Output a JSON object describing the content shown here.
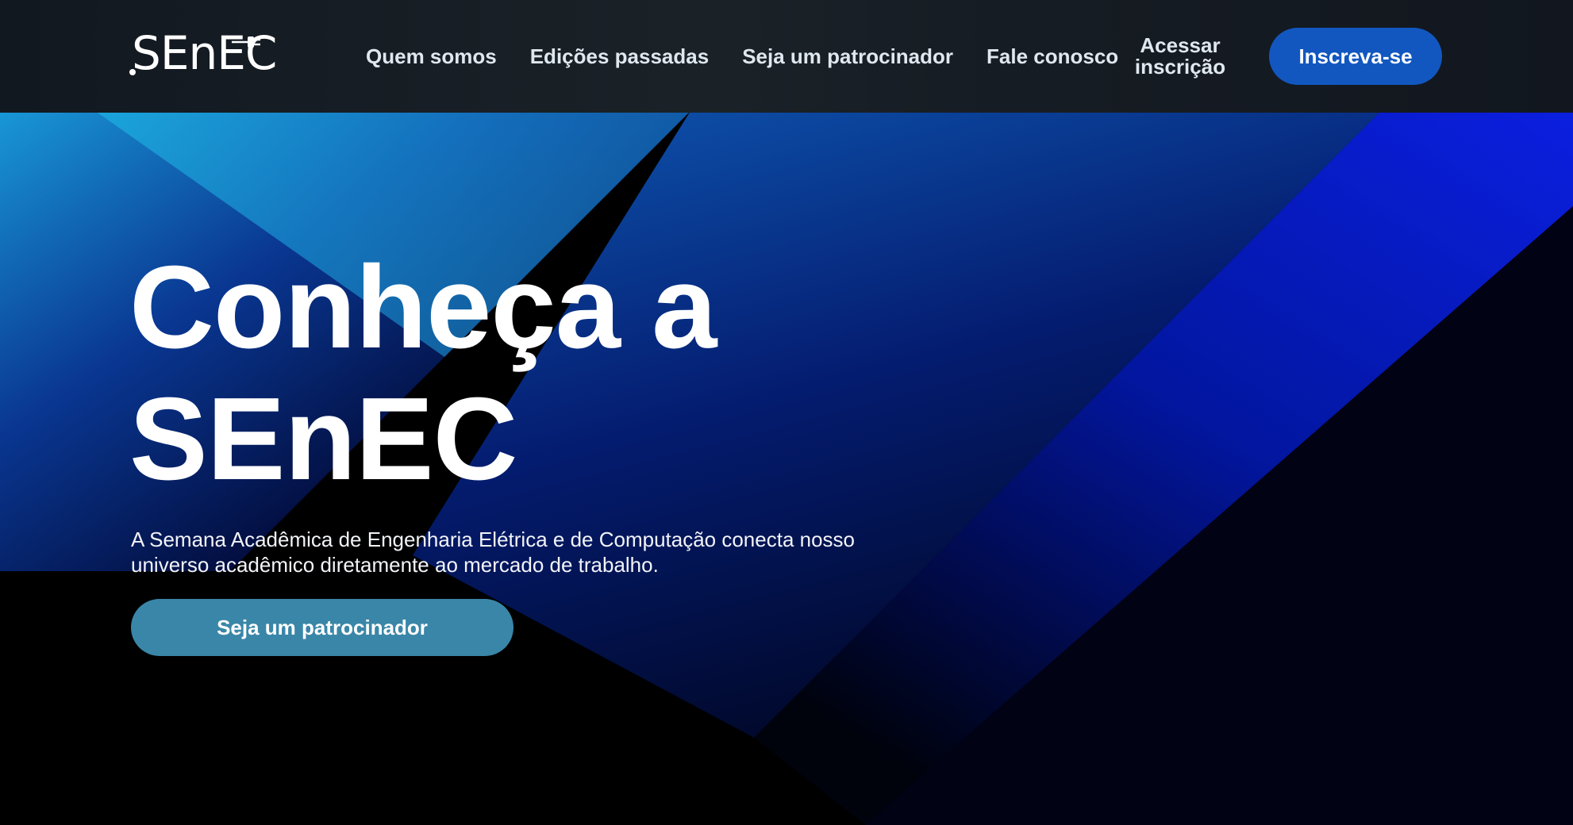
{
  "brand": {
    "logo_text": "SEnEC"
  },
  "nav": {
    "items": [
      {
        "label": "Quem somos"
      },
      {
        "label": "Edições passadas"
      },
      {
        "label": "Seja um patrocinador"
      },
      {
        "label": "Fale conosco"
      }
    ],
    "access_line1": "Acessar",
    "access_line2": "inscrição",
    "cta_label": "Inscreva-se"
  },
  "hero": {
    "title_line1": "Conheça a",
    "title_line2": "SEnEC",
    "description": "A Semana Acadêmica de Engenharia Elétrica e de Computação conecta nosso universo acadêmico diretamente ao mercado de trabalho.",
    "cta_label": "Seja um patrocinador"
  },
  "colors": {
    "nav_background": "#151b22",
    "nav_cta": "#1257c0",
    "hero_cta": "#3a86a8",
    "accent_blue": "#0a2bd8",
    "accent_cyan": "#1fb6e8"
  },
  "icons": [
    "plug-icon"
  ]
}
